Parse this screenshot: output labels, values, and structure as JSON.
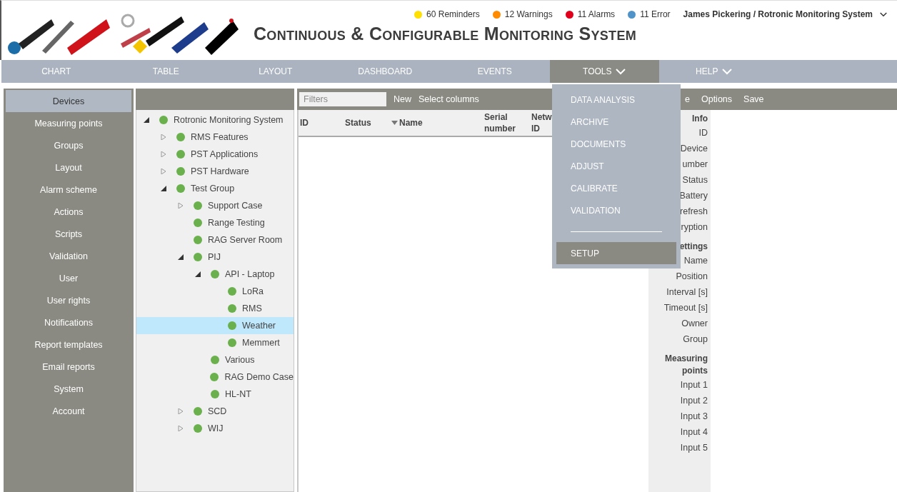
{
  "header": {
    "title": "Continuous & Configurable Monitoring System",
    "counters": [
      {
        "label": "60 Reminders",
        "color": "#ffe000"
      },
      {
        "label": "12 Warnings",
        "color": "#ff8c00"
      },
      {
        "label": "11 Alarms",
        "color": "#e0001b"
      },
      {
        "label": "11 Error",
        "color": "#4f93c8"
      }
    ],
    "user": "James Pickering / Rotronic Monitoring System"
  },
  "nav": [
    {
      "label": "CHART",
      "selected": false,
      "dropdown": false
    },
    {
      "label": "TABLE",
      "selected": false,
      "dropdown": false
    },
    {
      "label": "LAYOUT",
      "selected": false,
      "dropdown": false
    },
    {
      "label": "DASHBOARD",
      "selected": false,
      "dropdown": false
    },
    {
      "label": "EVENTS",
      "selected": false,
      "dropdown": false
    },
    {
      "label": "TOOLS",
      "selected": true,
      "dropdown": true
    },
    {
      "label": "HELP",
      "selected": false,
      "dropdown": true
    }
  ],
  "tools_menu": [
    {
      "kind": "item",
      "label": "DATA ANALYSIS",
      "selected": false
    },
    {
      "kind": "item",
      "label": "ARCHIVE",
      "selected": false
    },
    {
      "kind": "item",
      "label": "DOCUMENTS",
      "selected": false
    },
    {
      "kind": "item",
      "label": "ADJUST",
      "selected": false
    },
    {
      "kind": "item",
      "label": "CALIBRATE",
      "selected": false
    },
    {
      "kind": "item",
      "label": "VALIDATION",
      "selected": false
    },
    {
      "kind": "separator"
    },
    {
      "kind": "item",
      "label": "SETUP",
      "selected": true
    }
  ],
  "sidebar": [
    {
      "label": "Devices",
      "selected": true
    },
    {
      "label": "Measuring points",
      "selected": false
    },
    {
      "label": "Groups",
      "selected": false
    },
    {
      "label": "Layout",
      "selected": false
    },
    {
      "label": "Alarm scheme",
      "selected": false
    },
    {
      "label": "Actions",
      "selected": false
    },
    {
      "label": "Scripts",
      "selected": false
    },
    {
      "label": "Validation",
      "selected": false
    },
    {
      "label": "User",
      "selected": false
    },
    {
      "label": "User rights",
      "selected": false
    },
    {
      "label": "Notifications",
      "selected": false
    },
    {
      "label": "Report templates",
      "selected": false
    },
    {
      "label": "Email reports",
      "selected": false
    },
    {
      "label": "System",
      "selected": false
    },
    {
      "label": "Account",
      "selected": false
    }
  ],
  "tree": [
    {
      "label": "Rotronic Monitoring System",
      "selected": false,
      "expanded": true,
      "children": [
        {
          "label": "RMS Features",
          "selected": false,
          "expanded": false
        },
        {
          "label": "PST Applications",
          "selected": false,
          "expanded": false
        },
        {
          "label": "PST Hardware",
          "selected": false,
          "expanded": false
        },
        {
          "label": "Test Group",
          "selected": false,
          "expanded": true,
          "children": [
            {
              "label": "Support Case",
              "selected": false,
              "expanded": false
            },
            {
              "label": "Range Testing",
              "selected": false
            },
            {
              "label": "RAG Server Room",
              "selected": false
            },
            {
              "label": "PIJ",
              "selected": false,
              "expanded": true,
              "children": [
                {
                  "label": "API - Laptop",
                  "selected": false,
                  "expanded": true,
                  "children": [
                    {
                      "label": "LoRa",
                      "selected": false
                    },
                    {
                      "label": "RMS",
                      "selected": false
                    },
                    {
                      "label": "Weather",
                      "selected": true
                    },
                    {
                      "label": "Memmert",
                      "selected": false
                    }
                  ]
                },
                {
                  "label": "Various",
                  "selected": false
                },
                {
                  "label": "RAG Demo Case",
                  "selected": false
                },
                {
                  "label": "HL-NT",
                  "selected": false
                }
              ]
            },
            {
              "label": "SCD",
              "selected": false,
              "expanded": false
            },
            {
              "label": "WIJ",
              "selected": false,
              "expanded": false
            }
          ]
        }
      ]
    }
  ],
  "table_toolbar": {
    "filter": {
      "placeholder": "Filters"
    },
    "buttons": [
      "New",
      "Select columns"
    ]
  },
  "table": {
    "columns": [
      {
        "label": "ID",
        "sorted": false
      },
      {
        "label": "Status",
        "sorted": false
      },
      {
        "label": "Name",
        "sorted": true
      },
      {
        "label": "Serial number",
        "sorted": false
      },
      {
        "label": "Netw ID",
        "sorted": false
      }
    ]
  },
  "detail_toolbar": {
    "buttons": [
      "e",
      "Options",
      "Save"
    ]
  },
  "detail": [
    {
      "heading": "Info",
      "fields": [
        "ID",
        "Device",
        "umber",
        "Status",
        "Battery",
        "refresh",
        "ryption"
      ]
    },
    {
      "heading": "ettings",
      "fields": [
        "Name",
        "Position",
        "Interval [s]",
        "Timeout [s]",
        "Owner",
        "Group"
      ]
    },
    {
      "heading": "Measuring points",
      "fields": [
        "Input 1",
        "Input 2",
        "Input 3",
        "Input 4",
        "Input 5"
      ]
    }
  ]
}
